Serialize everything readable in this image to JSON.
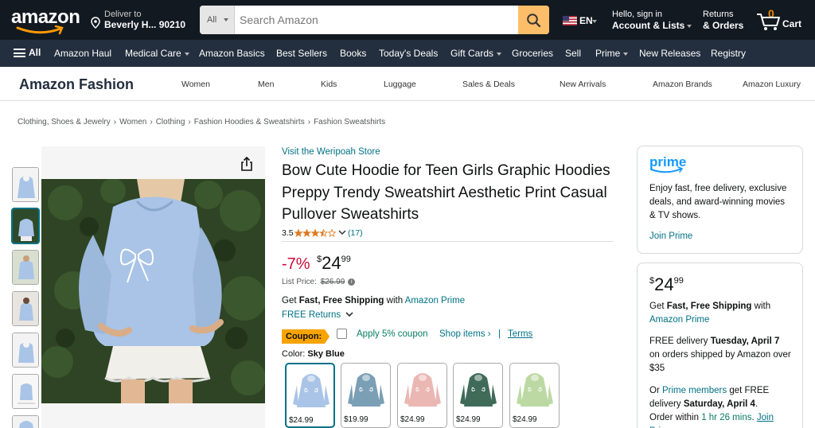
{
  "header": {
    "logo_text": "amazon",
    "deliver_line1": "Deliver to",
    "deliver_line2": "Beverly H... 90210",
    "search_category": "All",
    "search_placeholder": "Search Amazon",
    "language": "EN",
    "account_line1": "Hello, sign in",
    "account_line2": "Account & Lists",
    "orders_line1": "Returns",
    "orders_line2": "& Orders",
    "cart_count": "0",
    "cart_label": "Cart"
  },
  "subnav": {
    "all_label": "All",
    "items": [
      "Amazon Haul",
      "Medical Care",
      "Amazon Basics",
      "Best Sellers",
      "Books",
      "Today's Deals",
      "Gift Cards",
      "Groceries",
      "Sell",
      "Prime",
      "New Releases",
      "Registry"
    ]
  },
  "fashion": {
    "title": "Amazon Fashion",
    "categories": [
      "Women",
      "Men",
      "Kids",
      "Luggage",
      "Sales & Deals",
      "New Arrivals",
      "Amazon Brands",
      "Amazon Luxury"
    ]
  },
  "breadcrumbs": [
    "Clothing, Shoes & Jewelry",
    "Women",
    "Clothing",
    "Fashion Hoodies & Sweatshirts",
    "Fashion Sweatshirts"
  ],
  "product": {
    "store_link": "Visit the Weripoah Store",
    "title": "Bow Cute Hoodie for Teen Girls Graphic Hoodies Preppy Trendy Sweatshirt Aesthetic Print Casual Pullover Sweatshirts",
    "rating_value": "3.5",
    "rating_stars": 3.5,
    "review_count": "(17)",
    "discount": "-7%",
    "price_symbol": "$",
    "price_whole": "24",
    "price_fraction": "99",
    "list_price_label": "List Price:",
    "list_price": "$26.99",
    "shipping_prefix": "Get ",
    "shipping_bold": "Fast, Free Shipping",
    "shipping_mid": " with ",
    "shipping_link": "Amazon Prime",
    "free_returns": "FREE Returns",
    "coupon_label": "Coupon:",
    "coupon_text": "Apply 5% coupon",
    "shop_items": "Shop items ›",
    "pipe": "|",
    "terms": "Terms",
    "color_label": "Color:",
    "color_value": "Sky Blue",
    "swatches": [
      {
        "price": "$24.99",
        "color": "#a9c4e6",
        "selected": true
      },
      {
        "price": "$19.99",
        "color": "#7b9fb5"
      },
      {
        "price": "$24.99",
        "color": "#eab7b3"
      },
      {
        "price": "$24.99",
        "color": "#3f6b58"
      },
      {
        "price": "$24.99",
        "color": "#bcd9a4"
      }
    ]
  },
  "prime_box": {
    "logo": "prime",
    "description": "Enjoy fast, free delivery, exclusive deals, and award-winning movies & TV shows.",
    "join": "Join Prime"
  },
  "buy_box": {
    "price_symbol": "$",
    "price_whole": "24",
    "price_fraction": "99",
    "ship_prefix": "Get ",
    "ship_bold": "Fast, Free Shipping",
    "ship_suffix": " with",
    "ship_link": "Amazon Prime",
    "delivery_prefix": "FREE delivery ",
    "delivery_date": "Tuesday, April 7",
    "delivery_suffix": "on orders shipped by Amazon over $35",
    "or_prefix": "Or ",
    "prime_members": "Prime members",
    "or_mid": " get FREE delivery ",
    "fast_date": "Saturday, April 4",
    "fast_period": ".",
    "order_within": "Order within ",
    "countdown": "1 hr 26 mins",
    "countdown_period": ".",
    "join_link": "Join Prime"
  },
  "colors": {
    "nav_dark": "#131921",
    "nav_secondary": "#232f3e",
    "search_button": "#febd69",
    "link": "#007185",
    "discount_red": "#cc0c39",
    "coupon_orange": "#f7a300",
    "cart_count": "#f08804"
  }
}
